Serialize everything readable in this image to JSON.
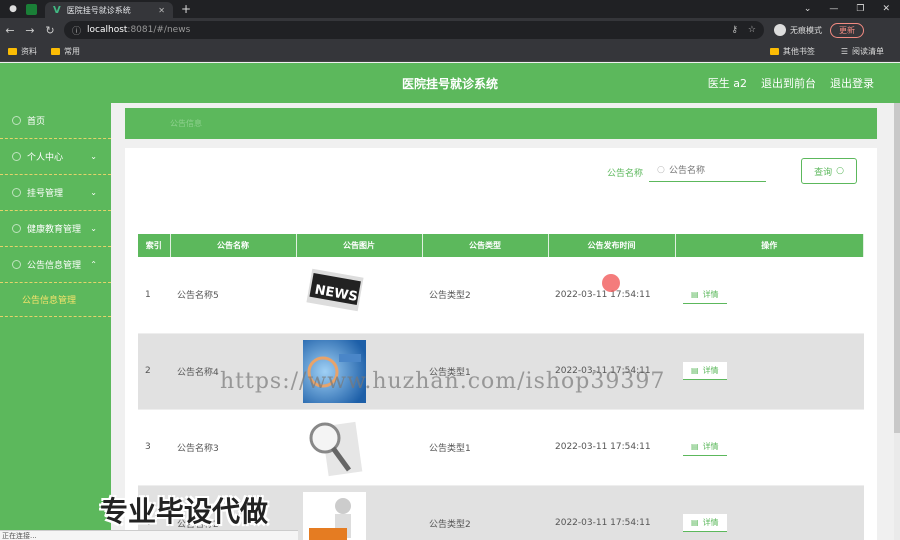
{
  "browser": {
    "tab_title": "医院挂号就诊系统",
    "url_host": "localhost",
    "url_path": ":8081/#/news",
    "profile_label": "无痕模式",
    "update_label": "更新",
    "bookmarks": [
      "资料",
      "常用"
    ],
    "bookmarks_right": [
      "其他书签",
      "阅读清单"
    ]
  },
  "header": {
    "title": "医院挂号就诊系统",
    "user": "医生 a2",
    "back_to_admin": "退出到前台",
    "logout": "退出登录"
  },
  "sidebar": {
    "items": [
      {
        "label": "首页",
        "chevron": ""
      },
      {
        "label": "个人中心",
        "chevron": "⌄"
      },
      {
        "label": "挂号管理",
        "chevron": "⌄"
      },
      {
        "label": "健康教育管理",
        "chevron": "⌄"
      },
      {
        "label": "公告信息管理",
        "chevron": "⌃"
      }
    ],
    "submenu": "公告信息管理"
  },
  "breadcrumb": "公告信息",
  "search": {
    "label": "公告名称",
    "placeholder": "公告名称",
    "button": "查询"
  },
  "table": {
    "headers": [
      "索引",
      "公告名称",
      "公告图片",
      "公告类型",
      "公告发布时间",
      "操作"
    ],
    "rows": [
      {
        "idx": "1",
        "name": "公告名称5",
        "type": "公告类型2",
        "time": "2022-03-11 17:54:11",
        "action": "详情"
      },
      {
        "idx": "2",
        "name": "公告名称4",
        "type": "公告类型1",
        "time": "2022-03-11 17:54:11",
        "action": "详情"
      },
      {
        "idx": "3",
        "name": "公告名称3",
        "type": "公告类型1",
        "time": "2022-03-11 17:54:11",
        "action": "详情"
      },
      {
        "idx": "4",
        "name": "公告名称2",
        "type": "公告类型2",
        "time": "2022-03-11 17:54:11",
        "action": "详情"
      }
    ]
  },
  "overlay": {
    "watermark": "https://www.huzhan.com/ishop39397",
    "promo": "专业毕设代做",
    "status": "正在连接..."
  },
  "colors": {
    "accent": "#5cb85c",
    "submenu": "#f7e36b"
  }
}
